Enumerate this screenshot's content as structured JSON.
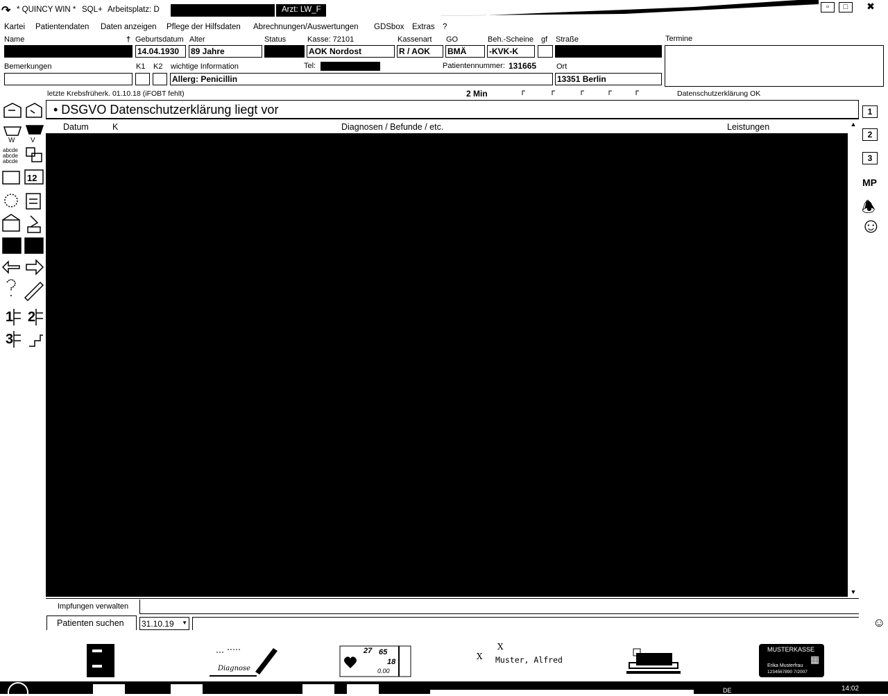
{
  "titlebar": {
    "app": "* QUINCY WIN *",
    "sql": "SQL+",
    "workplace_label": "Arbeitsplatz: D",
    "doctor_label": "Arzt: LW_F"
  },
  "menu": [
    "Kartei",
    "Patientendaten",
    "Daten anzeigen",
    "Pflege der Hilfsdaten",
    "Abrechnungen/Auswertungen",
    "GDSbox",
    "Extras",
    "?"
  ],
  "patient": {
    "labels": {
      "name": "Name",
      "dob": "Geburtsdatum",
      "age": "Alter",
      "status": "Status",
      "kasse": "Kasse: 72101",
      "kassenart": "Kassenart",
      "go": "GO",
      "beh": "Beh.-Scheine",
      "gf": "gf",
      "strasse": "Straße",
      "termine": "Termine",
      "bemerkungen": "Bemerkungen",
      "k1": "K1",
      "k2": "K2",
      "wichtig": "wichtige Information",
      "tel": "Tel:",
      "patnr_label": "Patientennummer:",
      "ort": "Ort",
      "dagger": "†"
    },
    "dob": "14.04.1930",
    "age": "89 Jahre",
    "kasse_name": "AOK Nordost",
    "kassenart": "R / AOK",
    "go": "BMÄ",
    "beh": "-KVK-K",
    "wichtig": "Allerg: Penicillin",
    "patnr": "131665",
    "ort": "13351 Berlin"
  },
  "infobar": {
    "krebs": "letzte Krebsfrüherk. 01.10.18 (iFOBT fehlt)",
    "min": "2 Min",
    "dsgvo_ok": "Datenschutzerklärung OK"
  },
  "banner": "•  DSGVO Datenschutzerklärung liegt vor",
  "columns": [
    "Datum",
    "K",
    "Diagnosen / Befunde / etc.",
    "Leistungen"
  ],
  "bottom": {
    "impfungen": "Impfungen verwalten",
    "suchen": "Patienten suchen",
    "date": "31.10.19"
  },
  "rightbar": [
    "1",
    "2",
    "3",
    "MP"
  ],
  "dock": {
    "diagnose_text": "Diagnose",
    "vitals": [
      "27",
      "65",
      "18",
      "0.00"
    ],
    "x1": "X",
    "x2": "X",
    "patient_name": "Muster, Alfred",
    "card_title": "MUSTERKASSE",
    "card_name": "Erika Musterfrau",
    "card_number": "1234567890  7/2007"
  },
  "taskbar": {
    "lang": "DE",
    "time": "14:02"
  },
  "icons": [
    "arrow-up-icon",
    "minimize-icon",
    "maximize-icon",
    "close-icon"
  ]
}
